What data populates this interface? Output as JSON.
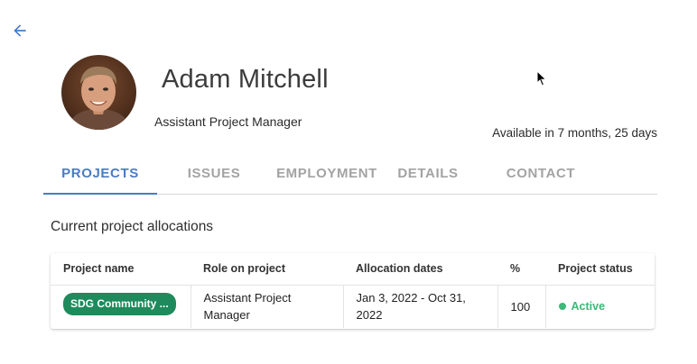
{
  "colors": {
    "accent": "#4a7cc4",
    "chip_bg": "#1f8a5b",
    "status_active": "#3cb878"
  },
  "header": {
    "back_icon": "arrow-left-icon",
    "name": "Adam Mitchell",
    "role": "Assistant Project Manager",
    "availability": "Available in 7 months, 25 days"
  },
  "tabs": [
    {
      "label": "PROJECTS",
      "active": true
    },
    {
      "label": "ISSUES",
      "active": false
    },
    {
      "label": "EMPLOYMENT",
      "active": false
    },
    {
      "label": "DETAILS",
      "active": false
    },
    {
      "label": "CONTACT",
      "active": false
    }
  ],
  "allocations": {
    "title": "Current project allocations",
    "columns": [
      "Project name",
      "Role on project",
      "Allocation dates",
      "%",
      "Project status"
    ],
    "rows": [
      {
        "project": "SDG Community ...",
        "role": "Assistant Project Manager",
        "dates": "Jan 3, 2022 - Oct 31, 2022",
        "percent": "100",
        "status": "Active"
      }
    ]
  }
}
